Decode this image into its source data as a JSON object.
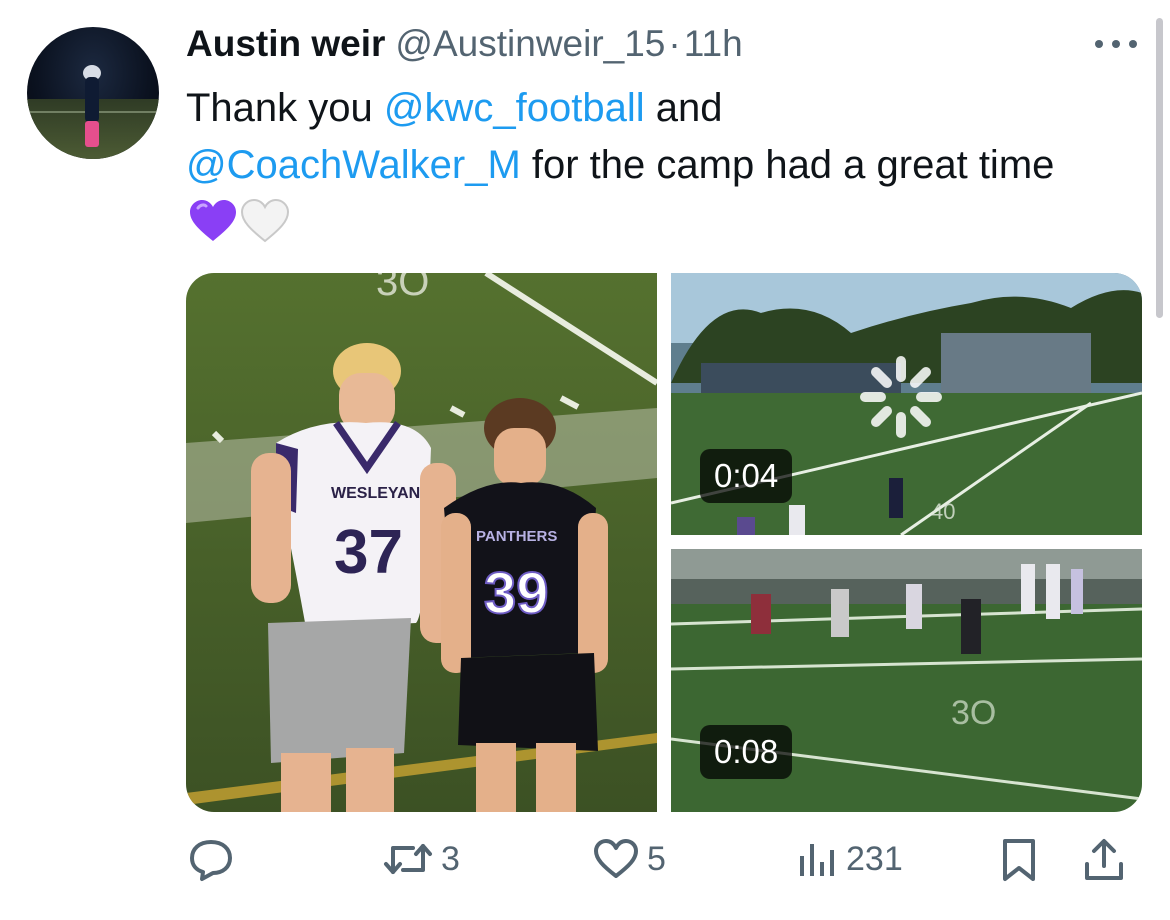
{
  "tweet": {
    "author_name": "Austin weir",
    "handle": "@Austinweir_15",
    "separator": "·",
    "time": "11h",
    "text_part1": "Thank you ",
    "mention1": "@kwc_football",
    "text_part2": " and ",
    "mention2": "@CoachWalker_M",
    "text_part3": " for the camp had a great time",
    "emojis": [
      "purple-heart",
      "white-heart"
    ]
  },
  "media": {
    "photo": {
      "jersey_left_team": "WESLEYAN",
      "jersey_left_number": "37",
      "jersey_right_team": "PANTHERS",
      "jersey_right_number": "39"
    },
    "videos": [
      {
        "duration": "0:04"
      },
      {
        "duration": "0:08"
      }
    ]
  },
  "actions": {
    "reply_count": "",
    "retweet_count": "3",
    "like_count": "5",
    "views_count": "231"
  },
  "colors": {
    "accent": "#1d9bf0",
    "secondary_text": "#536471",
    "primary_text": "#0f1419",
    "purple": "#8a3ff5"
  }
}
